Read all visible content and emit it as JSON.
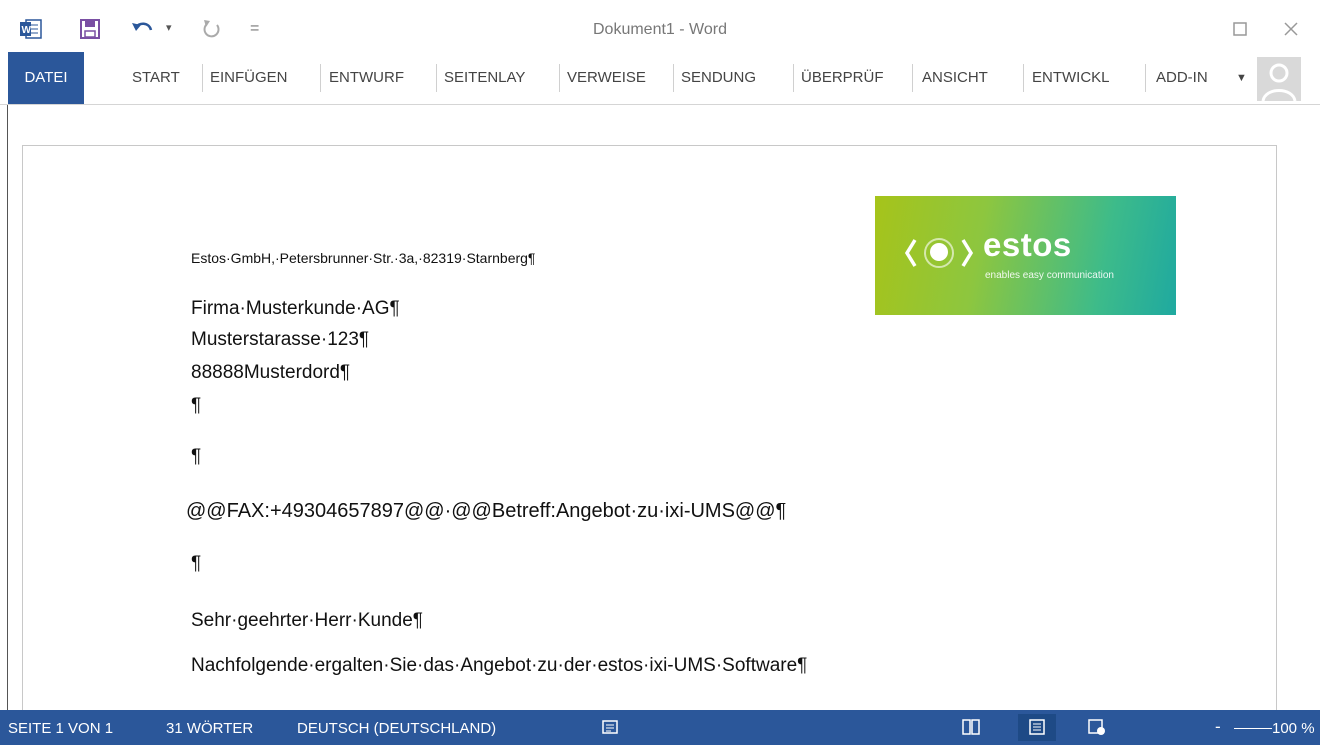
{
  "window": {
    "title": "Dokument1 - Word"
  },
  "qat": {
    "undo_dropdown": "▾",
    "customize": "="
  },
  "tabs": [
    {
      "label": "DATEI"
    },
    {
      "label": "START"
    },
    {
      "label": "EINFÜGEN"
    },
    {
      "label": "ENTWURF"
    },
    {
      "label": "SEITENLAY"
    },
    {
      "label": "VERWEISE"
    },
    {
      "label": "SENDUNG"
    },
    {
      "label": "ÜBERPRÜF"
    },
    {
      "label": "ANSICHT"
    },
    {
      "label": "ENTWICKL"
    },
    {
      "label": "ADD-IN"
    }
  ],
  "document": {
    "sender_line": "Estos·GmbH,·Petersbrunner·Str.·3a,·82319·Starnberg¶",
    "recipient": [
      "Firma·Musterkunde·AG¶",
      "Musterstarasse·123¶",
      "88888Musterdord¶"
    ],
    "pilcrow": "¶",
    "fax_line": "@@FAX:+49304657897@@·@@Betreff:Angebot·zu·ixi-UMS@@¶",
    "salutation": "Sehr·geehrter·Herr·Kunde¶",
    "body_line": "Nachfolgende·ergalten·Sie·das·Angebot·zu·der·estos·ixi-UMS·Software¶",
    "logo": {
      "word": "estos",
      "tagline": "enables easy communication"
    }
  },
  "status": {
    "page": "SEITE 1 VON 1",
    "words": "31 WÖRTER",
    "language": "DEUTSCH (DEUTSCHLAND)",
    "zoom_minus": "-",
    "zoom": "100 %"
  },
  "colors": {
    "accent": "#2b579a",
    "qat_save": "#7a4fa3",
    "qat_undo": "#2b579a"
  }
}
